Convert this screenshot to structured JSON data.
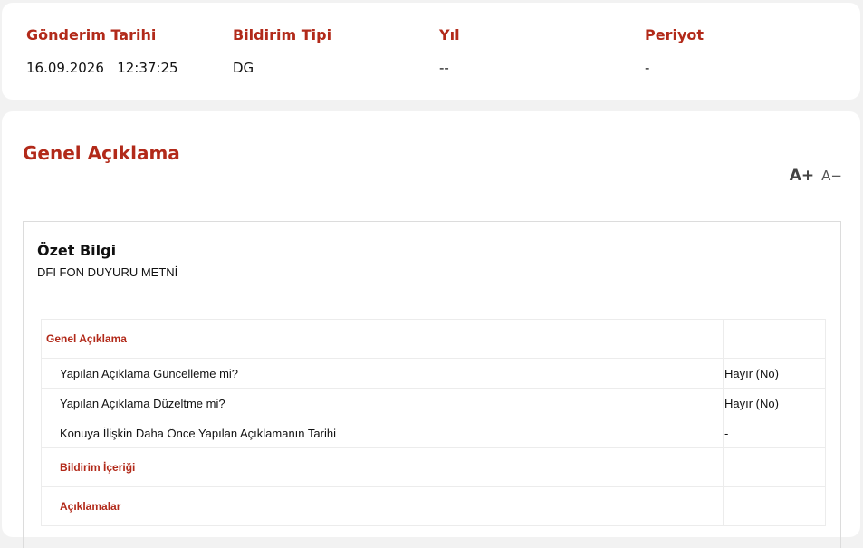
{
  "meta": {
    "columns": [
      {
        "label": "Gönderim Tarihi",
        "value": "16.09.2026   12:37:25"
      },
      {
        "label": "Bildirim Tipi",
        "value": "DG"
      },
      {
        "label": "Yıl",
        "value": "--"
      },
      {
        "label": "Periyot",
        "value": "-"
      }
    ]
  },
  "section": {
    "title": "Genel Açıklama",
    "font_increase": "A+",
    "font_decrease": "A−"
  },
  "summary": {
    "title": "Özet Bilgi",
    "text": "DFI FON DUYURU METNİ"
  },
  "table": {
    "header": "Genel Açıklama",
    "rows": [
      {
        "label": "Yapılan Açıklama Güncelleme mi?",
        "value": "Hayır (No)"
      },
      {
        "label": "Yapılan Açıklama Düzeltme mi?",
        "value": "Hayır (No)"
      },
      {
        "label": "Konuya İlişkin Daha Önce Yapılan Açıklamanın Tarihi",
        "value": "-"
      }
    ],
    "subsections": [
      "Bildirim İçeriği",
      "Açıklamalar"
    ]
  }
}
